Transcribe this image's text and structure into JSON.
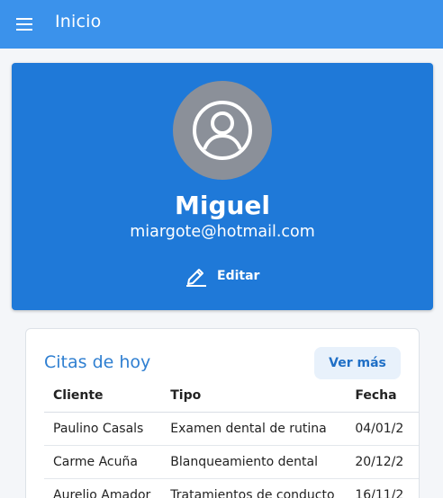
{
  "appbar": {
    "title": "Inicio",
    "menu_icon": "hamburger-menu-icon"
  },
  "profile": {
    "name": "Miguel",
    "email": "miargote@hotmail.com",
    "edit_label": "Editar",
    "avatar_icon": "user-circle-icon",
    "edit_icon": "pencil-icon",
    "card_color": "#1f79d8"
  },
  "appointments": {
    "title": "Citas de hoy",
    "more_label": "Ver más",
    "columns": [
      "Cliente",
      "Tipo",
      "Fecha"
    ],
    "rows": [
      [
        "Paulino Casals",
        "Examen dental de rutina",
        "04/01/2"
      ],
      [
        "Carme Acuña",
        "Blanqueamiento dental",
        "20/12/2"
      ],
      [
        "Aurelio Amador",
        "Tratamientos de conducto",
        "16/11/2"
      ]
    ]
  },
  "colors": {
    "appbar": "#3b92eb",
    "accent": "#2f7fd1",
    "background": "#f4f6f9"
  }
}
